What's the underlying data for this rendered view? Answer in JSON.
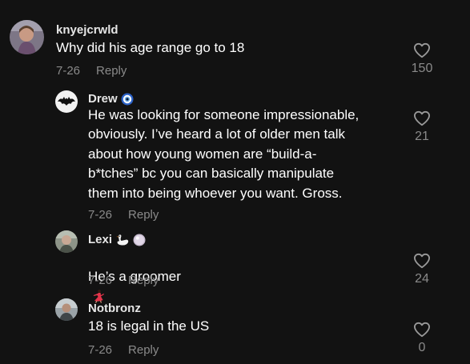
{
  "comments": [
    {
      "username": "knyejcrwld",
      "text": "Why did his age range go to 18",
      "date": "7-26",
      "reply": "Reply",
      "likes": "150",
      "avatar": "person-photo-avatar"
    },
    {
      "username": "Drew",
      "badge": "blue-eye-badge-icon",
      "text": "He was looking for someone impressionable,\nobviously. I’ve heard a lot of older men talk\nabout how young women are “build-a-\nb*tches” bc you can basically manipulate\nthem into being whoever you want. Gross.",
      "date": "7-26",
      "reply": "Reply",
      "likes": "21",
      "avatar": "bat-logo-avatar"
    },
    {
      "username": "Lexi",
      "badges": [
        "swan-icon",
        "pearl-icon"
      ],
      "text": "He’s a groomer",
      "emoji": "dancer-emoji-icon",
      "date": "7-26",
      "reply": "Reply",
      "likes": "24",
      "avatar": "person-photo-avatar"
    },
    {
      "username": "Notbronz",
      "text": "18 is legal in the US",
      "date": "7-26",
      "reply": "Reply",
      "likes": "0",
      "avatar": "person-photo-avatar"
    }
  ],
  "colors": {
    "background": "#121212",
    "text": "#ffffff",
    "muted": "#8a8a8a"
  }
}
